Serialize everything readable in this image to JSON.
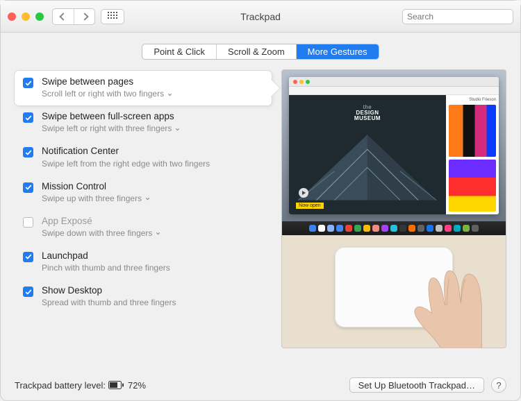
{
  "window": {
    "title": "Trackpad"
  },
  "search": {
    "placeholder": "Search"
  },
  "tabs": {
    "pointclick": "Point & Click",
    "scrollzoom": "Scroll & Zoom",
    "moregestures": "More Gestures"
  },
  "options": [
    {
      "title": "Swipe between pages",
      "subtitle": "Scroll left or right with two fingers",
      "checked": true,
      "has_dropdown": true,
      "selected": true,
      "disabled": false
    },
    {
      "title": "Swipe between full-screen apps",
      "subtitle": "Swipe left or right with three fingers",
      "checked": true,
      "has_dropdown": true,
      "selected": false,
      "disabled": false
    },
    {
      "title": "Notification Center",
      "subtitle": "Swipe left from the right edge with two fingers",
      "checked": true,
      "has_dropdown": false,
      "selected": false,
      "disabled": false
    },
    {
      "title": "Mission Control",
      "subtitle": "Swipe up with three fingers",
      "checked": true,
      "has_dropdown": true,
      "selected": false,
      "disabled": false
    },
    {
      "title": "App Exposé",
      "subtitle": "Swipe down with three fingers",
      "checked": false,
      "has_dropdown": true,
      "selected": false,
      "disabled": true
    },
    {
      "title": "Launchpad",
      "subtitle": "Pinch with thumb and three fingers",
      "checked": true,
      "has_dropdown": false,
      "selected": false,
      "disabled": false
    },
    {
      "title": "Show Desktop",
      "subtitle": "Spread with thumb and three fingers",
      "checked": true,
      "has_dropdown": false,
      "selected": false,
      "disabled": false
    }
  ],
  "preview": {
    "site_title_top": "the",
    "site_title_bottom": "DESIGN\nMUSEUM",
    "banner": "Now open",
    "sidebar_label": "Studio Frieson"
  },
  "footer": {
    "battery_label": "Trackpad battery level:",
    "battery_pct": "72%",
    "setup_button": "Set Up Bluetooth Trackpad…",
    "help": "?"
  },
  "dock_colors": [
    "#3b82f6",
    "#ffffff",
    "#8ab4f8",
    "#4285f4",
    "#ea4335",
    "#34a853",
    "#fbbc04",
    "#f28b82",
    "#a142f4",
    "#24c1e0",
    "#35363a",
    "#ff6d01",
    "#5f6368",
    "#1a73e8",
    "#c0c0c0",
    "#ff4081",
    "#00acc1",
    "#7cb342",
    "#616161"
  ]
}
